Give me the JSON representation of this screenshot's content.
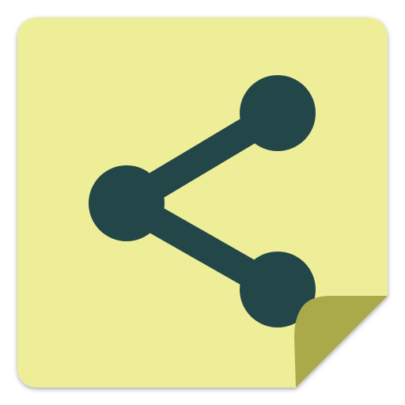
{
  "icon": {
    "name": "share-icon",
    "style": "sticky-note",
    "colors": {
      "note": "#EEEE99",
      "curl": "#AAAA4A",
      "symbol": "#234649",
      "shadow": "#9A9A9A"
    }
  }
}
